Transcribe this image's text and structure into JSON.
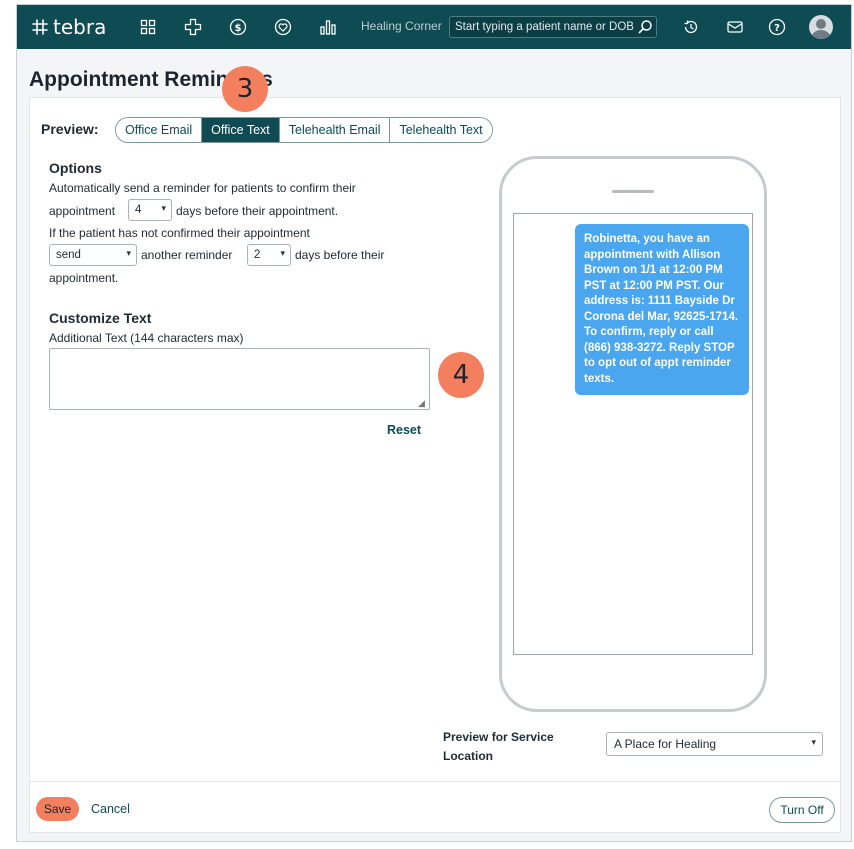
{
  "nav": {
    "brand": "tebra",
    "practice": "Healing Corner",
    "search_placeholder": "Start typing a patient name or DOB",
    "icons": [
      "grid-icon",
      "medical-cross-icon",
      "dollar-icon",
      "heart-shield-icon",
      "bar-chart-icon",
      "history-icon",
      "mail-icon",
      "help-icon",
      "avatar"
    ]
  },
  "page": {
    "title": "Appointment Reminders"
  },
  "preview": {
    "label": "Preview:",
    "tabs": [
      "Office Email",
      "Office Text",
      "Telehealth Email",
      "Telehealth Text"
    ],
    "active_tab": "Office Text"
  },
  "options": {
    "heading": "Options",
    "line1": "Automatically send a reminder for patients to confirm their",
    "line2_a": "appointment",
    "days_before_value": "4",
    "line2_b": "days before their appointment.",
    "line3": "If the patient has not confirmed their appointment",
    "action_value": "send",
    "line4_a": "another reminder",
    "reminder_days_value": "2",
    "line4_b": "days before their",
    "line5": "appointment."
  },
  "customize": {
    "heading": "Customize Text",
    "field_label": "Additional Text (144 characters max)",
    "field_value": "",
    "reset_label": "Reset"
  },
  "message_preview": "Robinetta, you have an appointment with Allison Brown on 1/1 at 12:00 PM PST at 12:00 PM PST. Our address is: 1111 Bayside Dr Corona del Mar, 92625-1714. To confirm, reply or call (866) 938-3272. Reply STOP to opt out of appt reminder texts.",
  "service_location": {
    "label": "Preview for Service Location",
    "value": "A Place for Healing"
  },
  "footer": {
    "save_label": "Save",
    "cancel_label": "Cancel",
    "turn_off_label": "Turn Off"
  },
  "annotations": {
    "badge_3": "3",
    "badge_4": "4"
  },
  "colors": {
    "nav_bg": "#0e4b53",
    "accent": "#f47f5f",
    "bubble": "#4aa6ef"
  }
}
